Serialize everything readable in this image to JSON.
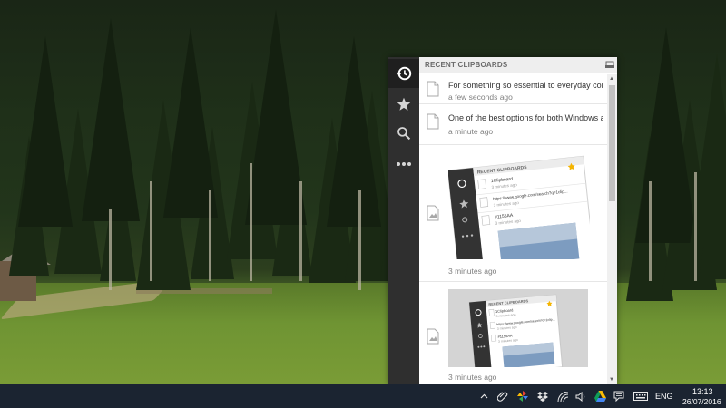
{
  "clipboard_app": {
    "title": "RECENT CLIPBOARDS",
    "sidebar": [
      {
        "name": "history-icon",
        "active": true
      },
      {
        "name": "star-icon",
        "active": false
      },
      {
        "name": "search-icon",
        "active": false
      },
      {
        "name": "more-icon",
        "active": false
      }
    ],
    "items": [
      {
        "type": "text",
        "text": "For something so essential to everyday com...",
        "time": "a few seconds ago"
      },
      {
        "type": "text",
        "text": "One of the best options for both Windows a...",
        "time": "a minute ago"
      },
      {
        "type": "image",
        "time": "3 minutes ago"
      },
      {
        "type": "image",
        "time": "3 minutes ago"
      }
    ],
    "thumbnail": {
      "title": "RECENT CLIPBOARDS",
      "entries": [
        {
          "text": "1Clipboard",
          "time": "3 minutes ago"
        },
        {
          "text": "https://www.google.com/search?q=1clip...",
          "time": "3 minutes ago"
        },
        {
          "text": "#1155AA",
          "time": "3 minutes ago"
        }
      ]
    }
  },
  "taskbar": {
    "language": "ENG",
    "time": "13:13",
    "date": "26/07/2016",
    "tray_icons": [
      "chevron-up-icon",
      "paperclip-icon",
      "pinwheel-icon",
      "dropbox-icon",
      "wifi-icon",
      "volume-icon",
      "drive-icon",
      "notification-icon",
      "keyboard-icon"
    ]
  }
}
